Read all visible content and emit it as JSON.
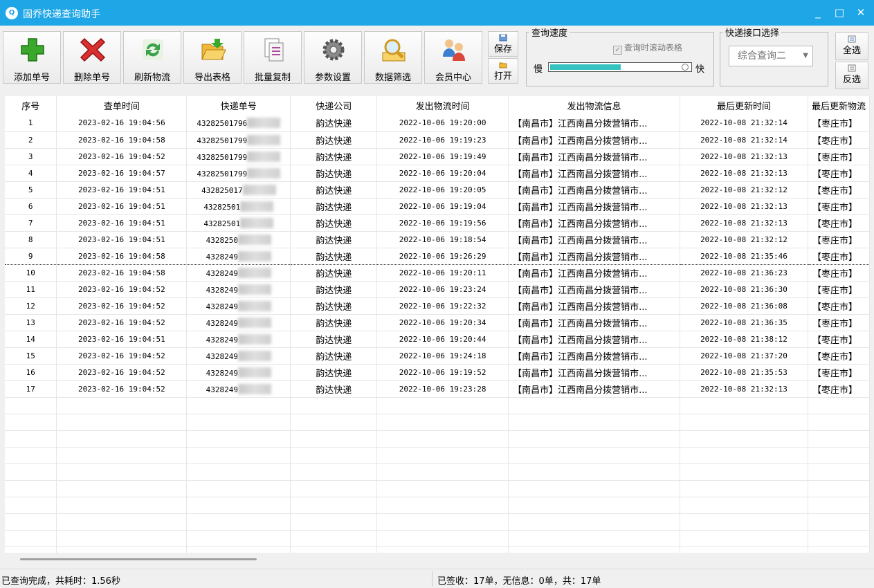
{
  "window": {
    "title": "固乔快递查询助手",
    "minimize": "_",
    "maximize": "□",
    "close": "✕"
  },
  "toolbar": {
    "buttons": [
      {
        "label": "添加单号",
        "icon": "plus-icon"
      },
      {
        "label": "删除单号",
        "icon": "delete-x-icon"
      },
      {
        "label": "刷新物流",
        "icon": "refresh-icon"
      },
      {
        "label": "导出表格",
        "icon": "folder-export-icon"
      },
      {
        "label": "批量复制",
        "icon": "copy-pages-icon"
      },
      {
        "label": "参数设置",
        "icon": "gear-icon"
      },
      {
        "label": "数据筛选",
        "icon": "magnifier-icon"
      },
      {
        "label": "会员中心",
        "icon": "users-icon"
      }
    ],
    "save_label": "保存",
    "open_label": "打开",
    "speed": {
      "legend": "查询速度",
      "scroll_checkbox_label": "查询时滚动表格",
      "scroll_checked": true,
      "slow_label": "慢",
      "fast_label": "快",
      "level": 0.5
    },
    "api": {
      "legend": "快递接口选择",
      "selected": "综合查询二"
    },
    "select_all_label": "全选",
    "invert_label": "反选"
  },
  "table": {
    "columns": [
      "序号",
      "查单时间",
      "快递单号",
      "快递公司",
      "发出物流时间",
      "发出物流信息",
      "最后更新时间",
      "最后更新物流"
    ],
    "rows": [
      {
        "no": "1",
        "query_time": "2023-02-16 19:04:56",
        "tracking": "43282501796",
        "company": "韵达快递",
        "send_time": "2022-10-06 19:20:00",
        "send_info": "【南昌市】江西南昌分拨营销市...",
        "update_time": "2022-10-08 21:32:14",
        "update_info": "【枣庄市】"
      },
      {
        "no": "2",
        "query_time": "2023-02-16 19:04:58",
        "tracking": "43282501799",
        "company": "韵达快递",
        "send_time": "2022-10-06 19:19:23",
        "send_info": "【南昌市】江西南昌分拨营销市...",
        "update_time": "2022-10-08 21:32:14",
        "update_info": "【枣庄市】"
      },
      {
        "no": "3",
        "query_time": "2023-02-16 19:04:52",
        "tracking": "43282501799",
        "company": "韵达快递",
        "send_time": "2022-10-06 19:19:49",
        "send_info": "【南昌市】江西南昌分拨营销市...",
        "update_time": "2022-10-08 21:32:13",
        "update_info": "【枣庄市】"
      },
      {
        "no": "4",
        "query_time": "2023-02-16 19:04:57",
        "tracking": "43282501799",
        "company": "韵达快递",
        "send_time": "2022-10-06 19:20:04",
        "send_info": "【南昌市】江西南昌分拨营销市...",
        "update_time": "2022-10-08 21:32:13",
        "update_info": "【枣庄市】"
      },
      {
        "no": "5",
        "query_time": "2023-02-16 19:04:51",
        "tracking": "432825017",
        "company": "韵达快递",
        "send_time": "2022-10-06 19:20:05",
        "send_info": "【南昌市】江西南昌分拨营销市...",
        "update_time": "2022-10-08 21:32:12",
        "update_info": "【枣庄市】"
      },
      {
        "no": "6",
        "query_time": "2023-02-16 19:04:51",
        "tracking": "43282501",
        "company": "韵达快递",
        "send_time": "2022-10-06 19:19:04",
        "send_info": "【南昌市】江西南昌分拨营销市...",
        "update_time": "2022-10-08 21:32:13",
        "update_info": "【枣庄市】"
      },
      {
        "no": "7",
        "query_time": "2023-02-16 19:04:51",
        "tracking": "43282501",
        "company": "韵达快递",
        "send_time": "2022-10-06 19:19:56",
        "send_info": "【南昌市】江西南昌分拨营销市...",
        "update_time": "2022-10-08 21:32:13",
        "update_info": "【枣庄市】"
      },
      {
        "no": "8",
        "query_time": "2023-02-16 19:04:51",
        "tracking": "4328250",
        "company": "韵达快递",
        "send_time": "2022-10-06 19:18:54",
        "send_info": "【南昌市】江西南昌分拨营销市...",
        "update_time": "2022-10-08 21:32:12",
        "update_info": "【枣庄市】"
      },
      {
        "no": "9",
        "query_time": "2023-02-16 19:04:58",
        "tracking": "4328249",
        "company": "韵达快递",
        "send_time": "2022-10-06 19:26:29",
        "send_info": "【南昌市】江西南昌分拨营销市...",
        "update_time": "2022-10-08 21:35:46",
        "update_info": "【枣庄市】"
      },
      {
        "no": "10",
        "query_time": "2023-02-16 19:04:58",
        "tracking": "4328249",
        "company": "韵达快递",
        "send_time": "2022-10-06 19:20:11",
        "send_info": "【南昌市】江西南昌分拨营销市...",
        "update_time": "2022-10-08 21:36:23",
        "update_info": "【枣庄市】"
      },
      {
        "no": "11",
        "query_time": "2023-02-16 19:04:52",
        "tracking": "4328249",
        "company": "韵达快递",
        "send_time": "2022-10-06 19:23:24",
        "send_info": "【南昌市】江西南昌分拨营销市...",
        "update_time": "2022-10-08 21:36:30",
        "update_info": "【枣庄市】"
      },
      {
        "no": "12",
        "query_time": "2023-02-16 19:04:52",
        "tracking": "4328249",
        "company": "韵达快递",
        "send_time": "2022-10-06 19:22:32",
        "send_info": "【南昌市】江西南昌分拨营销市...",
        "update_time": "2022-10-08 21:36:08",
        "update_info": "【枣庄市】"
      },
      {
        "no": "13",
        "query_time": "2023-02-16 19:04:52",
        "tracking": "4328249",
        "company": "韵达快递",
        "send_time": "2022-10-06 19:20:34",
        "send_info": "【南昌市】江西南昌分拨营销市...",
        "update_time": "2022-10-08 21:36:35",
        "update_info": "【枣庄市】"
      },
      {
        "no": "14",
        "query_time": "2023-02-16 19:04:51",
        "tracking": "4328249",
        "company": "韵达快递",
        "send_time": "2022-10-06 19:20:44",
        "send_info": "【南昌市】江西南昌分拨营销市...",
        "update_time": "2022-10-08 21:38:12",
        "update_info": "【枣庄市】"
      },
      {
        "no": "15",
        "query_time": "2023-02-16 19:04:52",
        "tracking": "4328249",
        "company": "韵达快递",
        "send_time": "2022-10-06 19:24:18",
        "send_info": "【南昌市】江西南昌分拨营销市...",
        "update_time": "2022-10-08 21:37:20",
        "update_info": "【枣庄市】"
      },
      {
        "no": "16",
        "query_time": "2023-02-16 19:04:52",
        "tracking": "4328249",
        "company": "韵达快递",
        "send_time": "2022-10-06 19:19:52",
        "send_info": "【南昌市】江西南昌分拨营销市...",
        "update_time": "2022-10-08 21:35:53",
        "update_info": "【枣庄市】"
      },
      {
        "no": "17",
        "query_time": "2023-02-16 19:04:52",
        "tracking": "4328249",
        "company": "韵达快递",
        "send_time": "2022-10-06 19:23:28",
        "send_info": "【南昌市】江西南昌分拨营销市...",
        "update_time": "2022-10-08 21:32:13",
        "update_info": "【枣庄市】"
      }
    ],
    "selected_row": 9
  },
  "status": {
    "left": "已查询完成，共耗时：1.56秒",
    "right": "已签收：17单，无信息：0单，共：17单"
  },
  "colors": {
    "titlebar": "#1ea6e6",
    "slider_fill": "#35c3c1"
  }
}
